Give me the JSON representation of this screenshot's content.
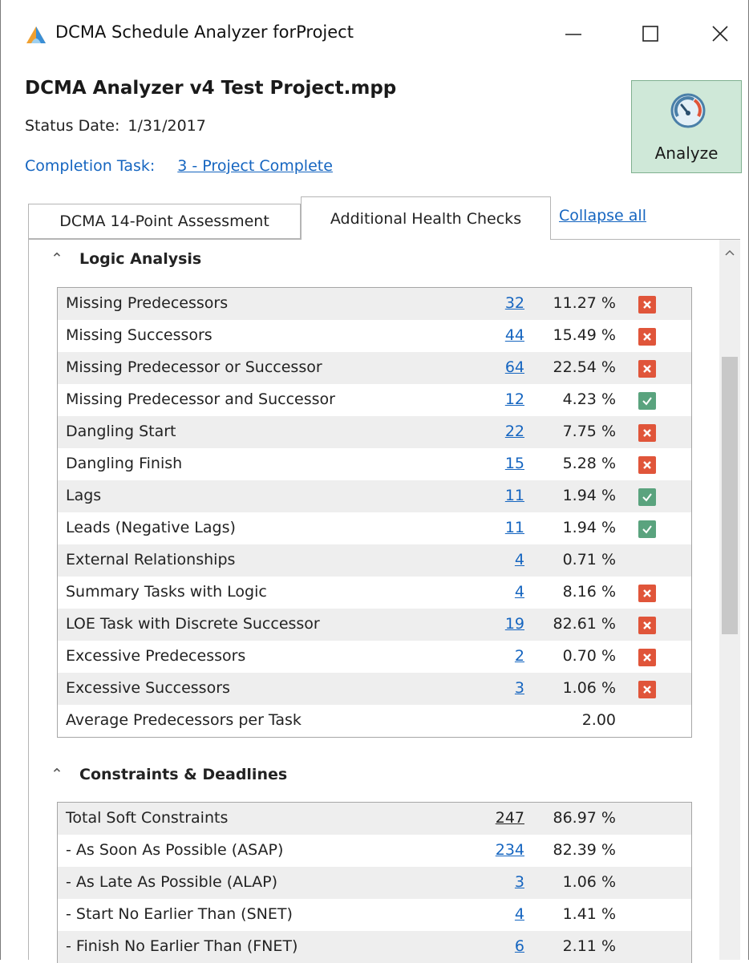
{
  "window": {
    "title": "DCMA Schedule Analyzer forProject"
  },
  "project": {
    "file_name": "DCMA Analyzer v4 Test Project.mpp",
    "status_label": "Status Date:",
    "status_value": "1/31/2017",
    "completion_label": "Completion Task:",
    "completion_value": "3 - Project Complete"
  },
  "analyze_button": {
    "label": "Analyze"
  },
  "tabs": [
    {
      "label": "DCMA 14-Point Assessment",
      "active": false
    },
    {
      "label": "Additional Health Checks",
      "active": true
    }
  ],
  "collapse_all": "Collapse all",
  "sections": {
    "logic": {
      "title": "Logic Analysis",
      "rows": [
        {
          "label": "Missing Predecessors",
          "count": "32",
          "pct": "11.27 %",
          "status": "fail"
        },
        {
          "label": "Missing Successors",
          "count": "44",
          "pct": "15.49 %",
          "status": "fail"
        },
        {
          "label": "Missing Predecessor or Successor",
          "count": "64",
          "pct": "22.54 %",
          "status": "fail"
        },
        {
          "label": "Missing Predecessor and Successor",
          "count": "12",
          "pct": "4.23 %",
          "status": "pass"
        },
        {
          "label": "Dangling Start",
          "count": "22",
          "pct": "7.75 %",
          "status": "fail"
        },
        {
          "label": "Dangling Finish",
          "count": "15",
          "pct": "5.28 %",
          "status": "fail"
        },
        {
          "label": "Lags",
          "count": "11",
          "pct": "1.94 %",
          "status": "pass"
        },
        {
          "label": "Leads (Negative Lags)",
          "count": "11",
          "pct": "1.94 %",
          "status": "pass"
        },
        {
          "label": "External Relationships",
          "count": "4",
          "pct": "0.71 %",
          "status": "none"
        },
        {
          "label": "Summary Tasks with Logic",
          "count": "4",
          "pct": "8.16 %",
          "status": "fail"
        },
        {
          "label": "LOE Task with Discrete Successor",
          "count": "19",
          "pct": "82.61 %",
          "status": "fail"
        },
        {
          "label": "Excessive Predecessors",
          "count": "2",
          "pct": "0.70 %",
          "status": "fail"
        },
        {
          "label": "Excessive Successors",
          "count": "3",
          "pct": "1.06 %",
          "status": "fail"
        },
        {
          "label": "Average Predecessors per Task",
          "count": "",
          "pct": "2.00",
          "status": "none"
        }
      ]
    },
    "constraints": {
      "title": "Constraints & Deadlines",
      "rows": [
        {
          "label": "Total Soft Constraints",
          "count": "247",
          "pct": "86.97 %",
          "status": "none",
          "plain": true
        },
        {
          "label": "- As Soon As Possible (ASAP)",
          "count": "234",
          "pct": "82.39 %",
          "status": "none"
        },
        {
          "label": "- As Late As Possible (ALAP)",
          "count": "3",
          "pct": "1.06 %",
          "status": "none"
        },
        {
          "label": "- Start No Earlier Than (SNET)",
          "count": "4",
          "pct": "1.41 %",
          "status": "none"
        },
        {
          "label": "- Finish No Earlier Than (FNET)",
          "count": "6",
          "pct": "2.11 %",
          "status": "none"
        }
      ]
    }
  },
  "colors": {
    "fail": "#e0553a",
    "pass": "#5aa37e",
    "link": "#1565c0",
    "analyze_bg": "#cfe8d8"
  }
}
